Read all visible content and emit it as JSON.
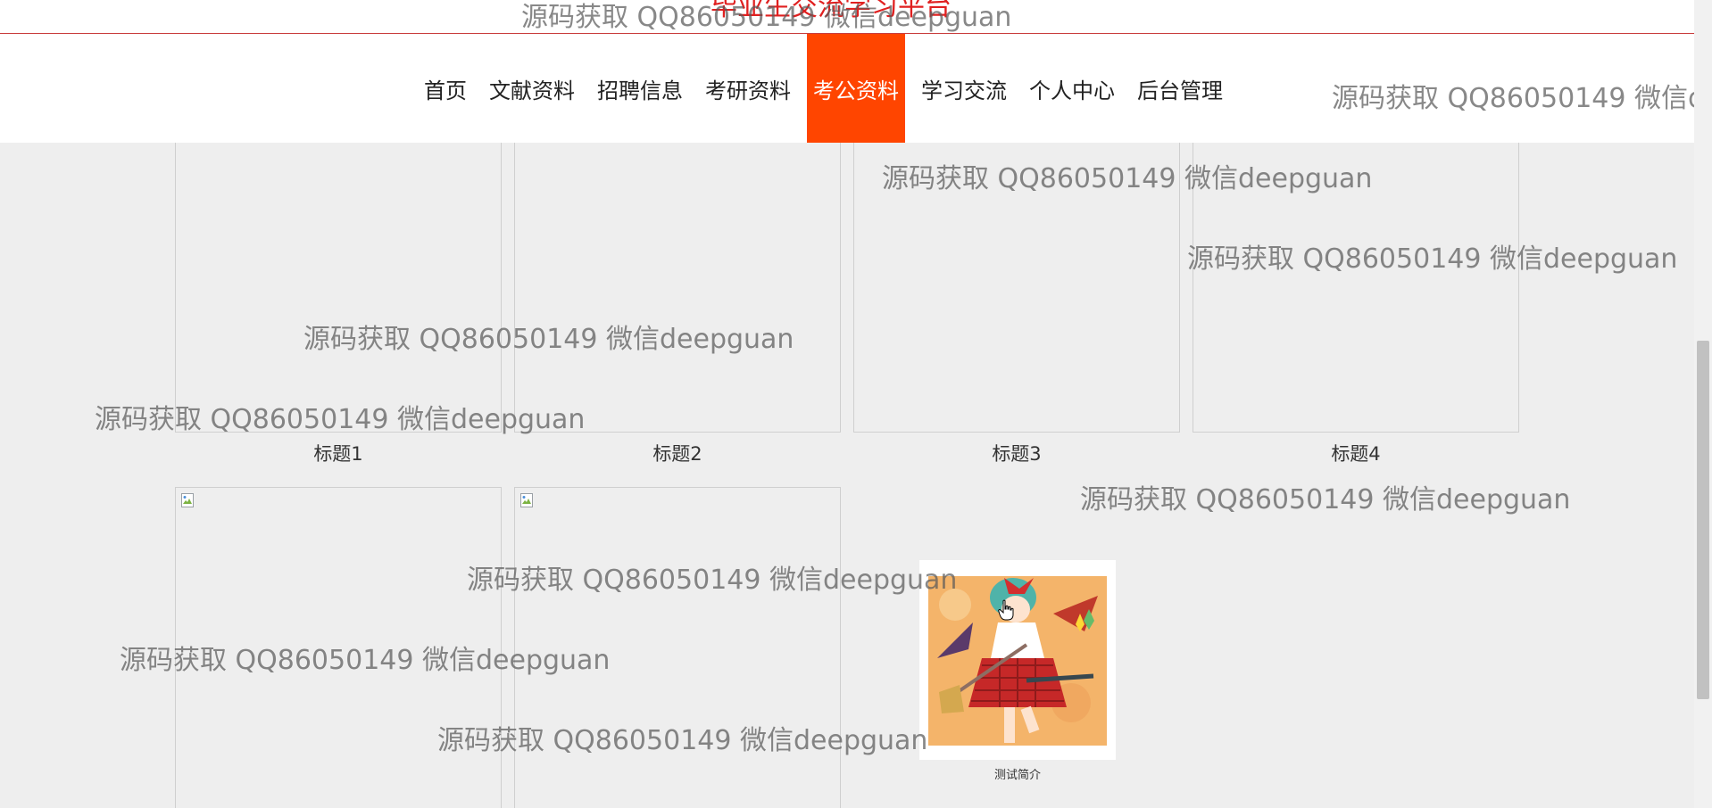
{
  "header": {
    "site_title": "毕业生交流学习平台",
    "nav": [
      {
        "label": "首页"
      },
      {
        "label": "文献资料"
      },
      {
        "label": "招聘信息"
      },
      {
        "label": "考研资料"
      },
      {
        "label": "考公资料",
        "active": true
      },
      {
        "label": "学习交流"
      },
      {
        "label": "个人中心"
      },
      {
        "label": "后台管理"
      }
    ],
    "accent_color": "#ff4500"
  },
  "cards_row1": [
    {
      "caption": "标题1"
    },
    {
      "caption": "标题2"
    },
    {
      "caption": "标题3"
    },
    {
      "caption": "标题4"
    }
  ],
  "cards_row2": [
    {
      "caption": ""
    },
    {
      "caption": ""
    },
    {
      "caption": "测试简介",
      "image": "anime-girl-illustration"
    }
  ],
  "watermark_text": "源码获取 QQ86050149 微信deepguan",
  "icons": {
    "broken_image": "broken-image-icon",
    "cursor": "hand-cursor-icon"
  }
}
